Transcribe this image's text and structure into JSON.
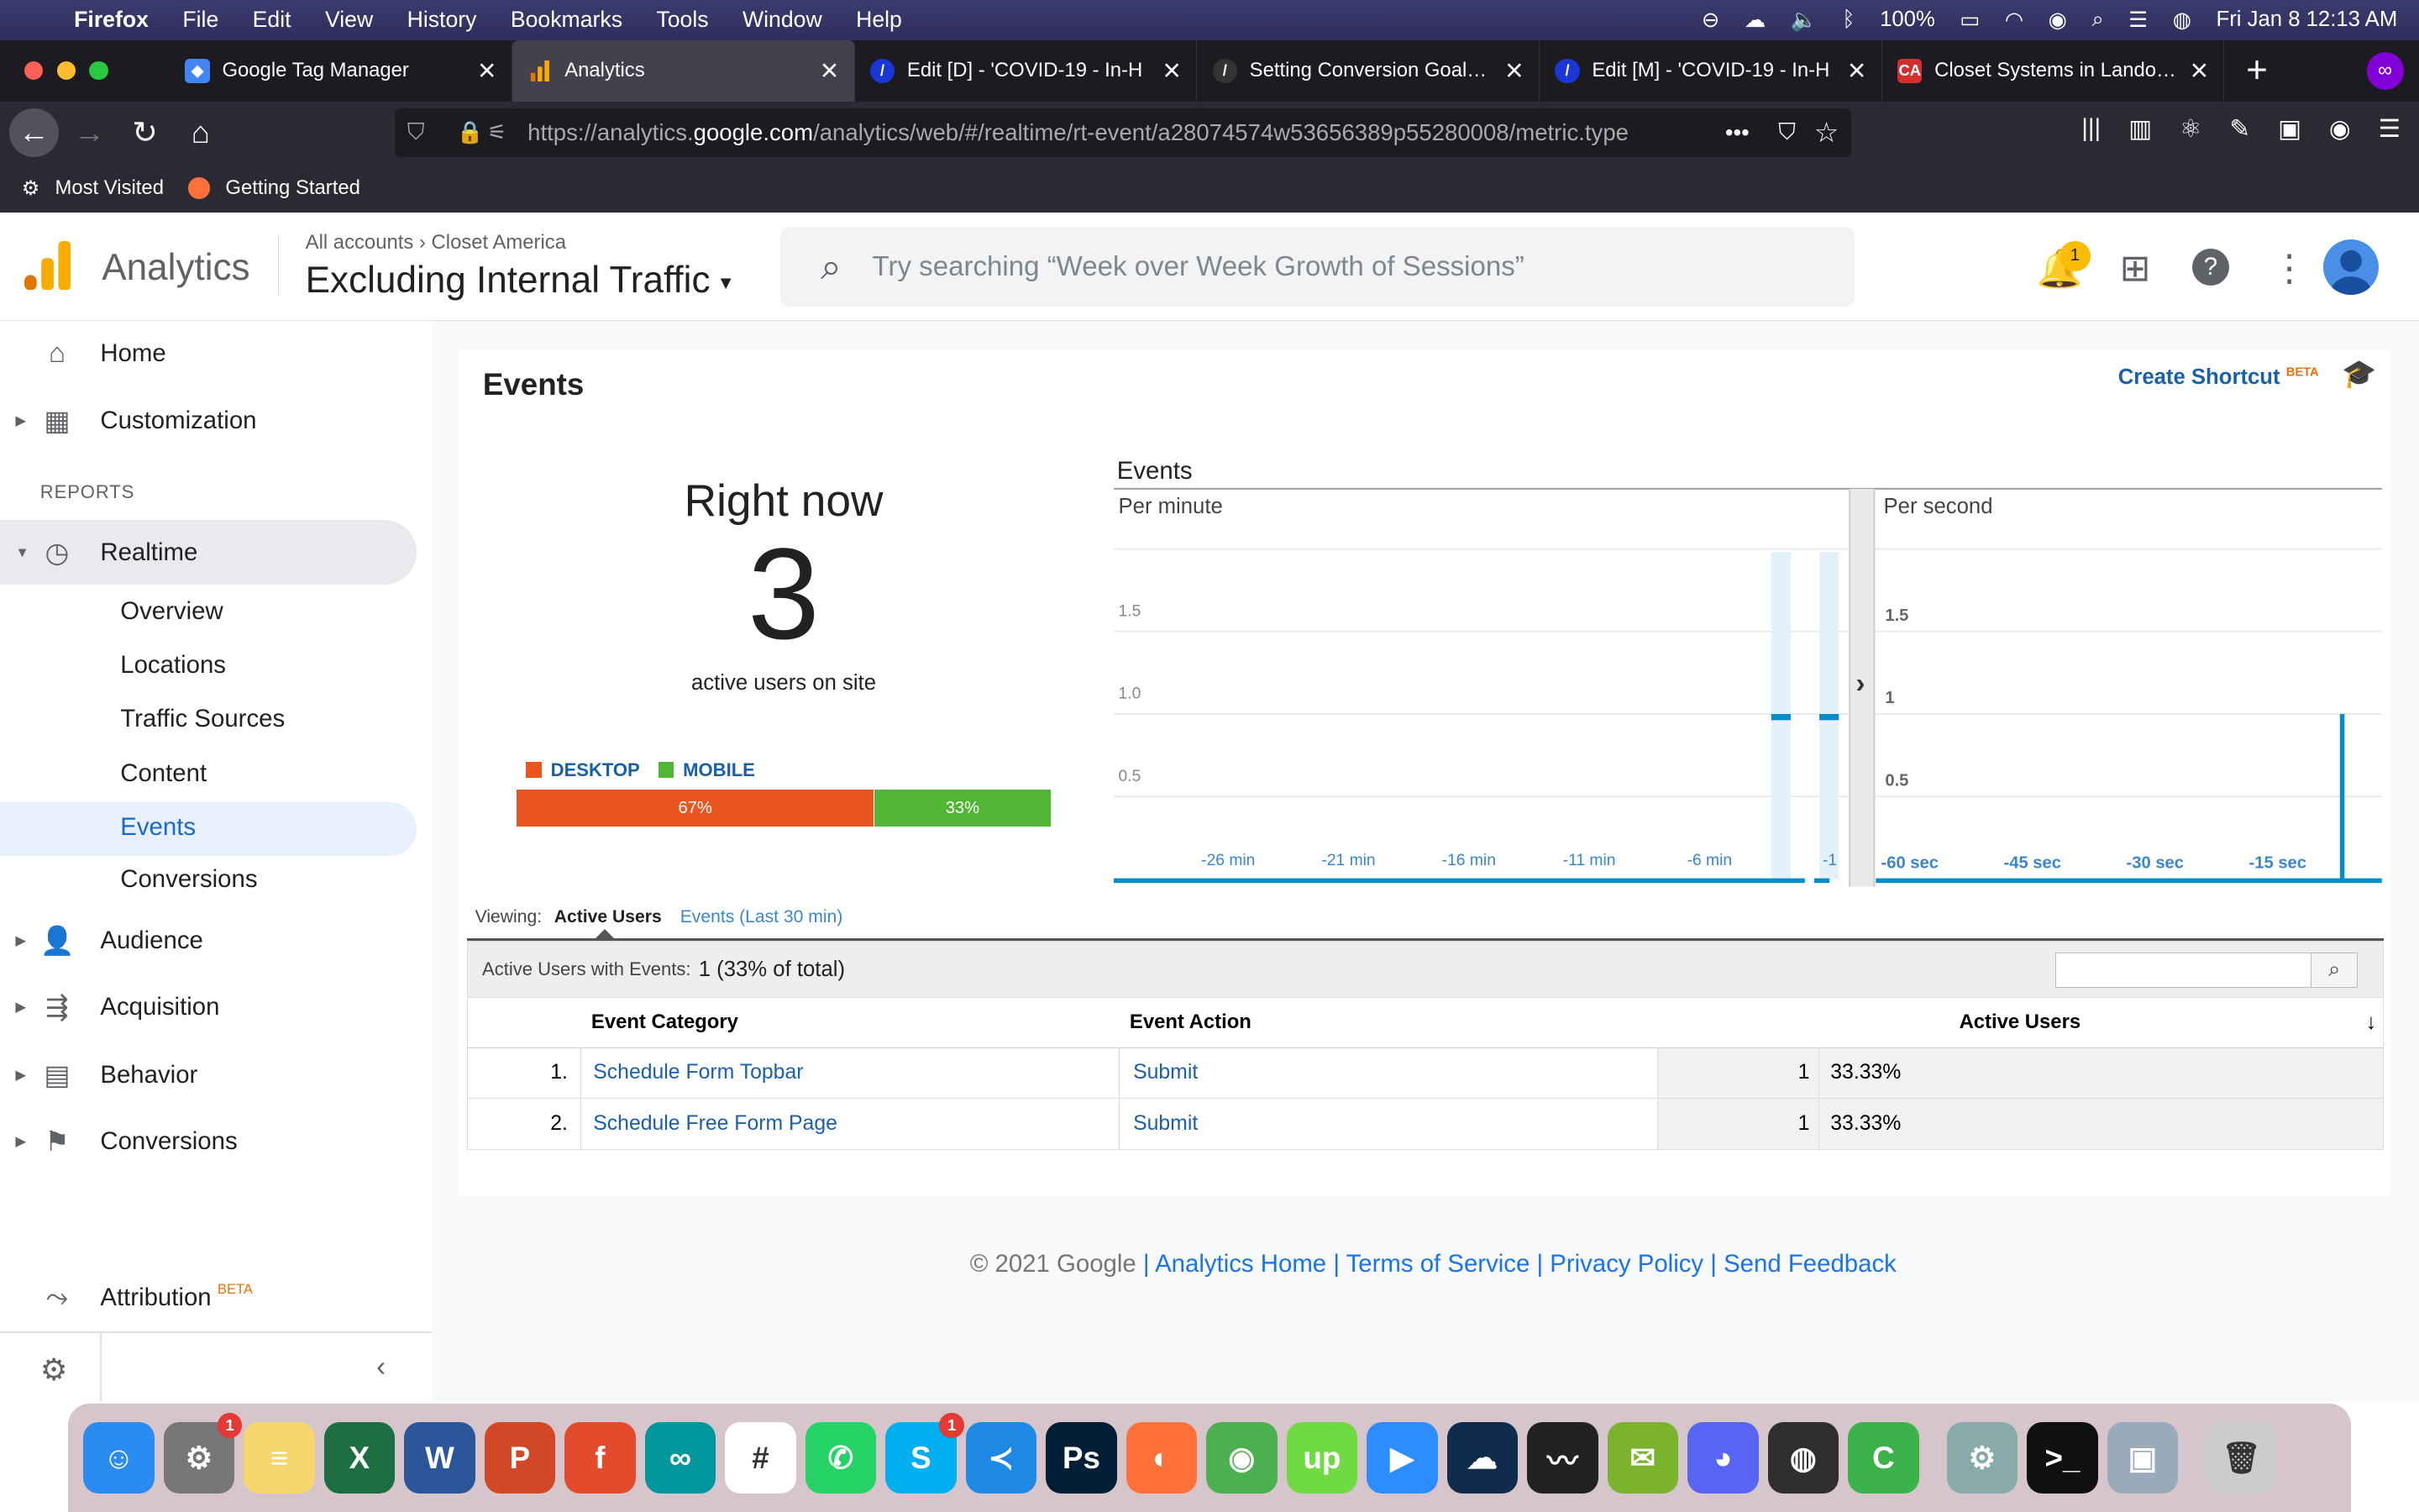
{
  "menubar": {
    "app": "Firefox",
    "items": [
      "File",
      "Edit",
      "View",
      "History",
      "Bookmarks",
      "Tools",
      "Window",
      "Help"
    ],
    "battery": "100%",
    "datetime": "Fri Jan 8  12:13 AM"
  },
  "tabs": [
    {
      "title": "Google Tag Manager",
      "favicon_color": "#4285f4"
    },
    {
      "title": "Analytics",
      "favicon_color": "#f9ab00"
    },
    {
      "title": "Edit [D] - 'COVID-19 - In-H",
      "favicon_color": "#1a37d6"
    },
    {
      "title": "Setting Conversion Goals –",
      "favicon_color": "#333333"
    },
    {
      "title": "Edit [M] - 'COVID-19 - In-H",
      "favicon_color": "#1a37d6"
    },
    {
      "title": "Closet Systems in Landover",
      "favicon_color": "#d32f2f"
    }
  ],
  "url": {
    "prefix": "https://analytics.",
    "domain": "google.com",
    "rest": "/analytics/web/#/realtime/rt-event/a28074574w53656389p55280008/metric.type"
  },
  "bookmarks": [
    "Most Visited",
    "Getting Started"
  ],
  "ga": {
    "product": "Analytics",
    "breadcrumb_all": "All accounts",
    "breadcrumb_sep": "›",
    "breadcrumb_account": "Closet America",
    "view_name": "Excluding Internal Traffic",
    "search_placeholder": "Try searching “Week over Week Growth of Sessions”",
    "notif_count": "1"
  },
  "sidebar": {
    "home": "Home",
    "customization": "Customization",
    "reports_header": "REPORTS",
    "realtime": "Realtime",
    "realtime_sub": [
      "Overview",
      "Locations",
      "Traffic Sources",
      "Content",
      "Events",
      "Conversions"
    ],
    "audience": "Audience",
    "acquisition": "Acquisition",
    "behavior": "Behavior",
    "conversions": "Conversions",
    "attribution": "Attribution",
    "attribution_badge": "BETA"
  },
  "report": {
    "title": "Events",
    "create_shortcut": "Create Shortcut",
    "create_badge": "BETA",
    "right_now": "Right now",
    "active_users": "3",
    "active_label": "active users on site",
    "desktop_label": "DESKTOP",
    "mobile_label": "MOBILE",
    "desktop_pct": "67%",
    "mobile_pct": "33%",
    "desktop_share": 0.67,
    "chart_title": "Events",
    "per_minute": "Per minute",
    "per_second": "Per second",
    "viewing_label": "Viewing:",
    "viewing_active": "Active Users",
    "viewing_events": "Events (Last 30 min)",
    "summary_label": "Active Users with Events:",
    "summary_value": "1 (33% of total)",
    "columns": [
      "Event Category",
      "Event Action",
      "Active Users"
    ],
    "rows": [
      {
        "idx": "1.",
        "category": "Schedule Form Topbar",
        "action": "Submit",
        "users": "1",
        "pct": "33.33%"
      },
      {
        "idx": "2.",
        "category": "Schedule Free Form Page",
        "action": "Submit",
        "users": "1",
        "pct": "33.33%"
      }
    ]
  },
  "footer": {
    "copyright": "© 2021 Google",
    "links": [
      "Analytics Home",
      "Terms of Service",
      "Privacy Policy",
      "Send Feedback"
    ]
  },
  "chart_data": [
    {
      "type": "bar",
      "title": "Per minute",
      "x_ticks": [
        "-26 min",
        "-21 min",
        "-16 min",
        "-11 min",
        "-6 min",
        "-1"
      ],
      "y_ticks": [
        "0.5",
        "1.0",
        "1.5"
      ],
      "ylim": [
        0,
        2
      ],
      "x": [
        -30,
        -29,
        -28,
        -27,
        -26,
        -25,
        -24,
        -23,
        -22,
        -21,
        -20,
        -19,
        -18,
        -17,
        -16,
        -15,
        -14,
        -13,
        -12,
        -11,
        -10,
        -9,
        -8,
        -7,
        -6,
        -5,
        -4,
        -3,
        -2,
        -1
      ],
      "values": [
        0,
        0,
        0,
        0,
        0,
        0,
        0,
        0,
        0,
        0,
        0,
        0,
        0,
        0,
        0,
        0,
        0,
        0,
        0,
        0,
        0,
        0,
        0,
        0,
        0,
        0,
        0,
        1,
        0,
        1
      ]
    },
    {
      "type": "bar",
      "title": "Per second",
      "x_ticks": [
        "-60 sec",
        "-45 sec",
        "-30 sec",
        "-15 sec"
      ],
      "y_ticks": [
        "0.5",
        "1",
        "1.5"
      ],
      "ylim": [
        0,
        2
      ],
      "x": [
        -4
      ],
      "values": [
        1
      ]
    }
  ],
  "dock": [
    {
      "name": "finder",
      "color": "#2a8cf0",
      "label": "☺"
    },
    {
      "name": "system-preferences",
      "color": "#777",
      "label": "⚙",
      "badge": "1"
    },
    {
      "name": "notes",
      "color": "#f5d76e",
      "label": "≡"
    },
    {
      "name": "excel",
      "color": "#1d6f42",
      "label": "X"
    },
    {
      "name": "word",
      "color": "#2b579a",
      "label": "W"
    },
    {
      "name": "powerpoint",
      "color": "#d24726",
      "label": "P"
    },
    {
      "name": "fontforge",
      "color": "#e34b2d",
      "label": "f"
    },
    {
      "name": "arduino",
      "color": "#00979c",
      "label": "∞"
    },
    {
      "name": "slack",
      "color": "#fff",
      "label": "#"
    },
    {
      "name": "whatsapp",
      "color": "#25d366",
      "label": "✆"
    },
    {
      "name": "skype",
      "color": "#00aff0",
      "label": "S",
      "badge": "1"
    },
    {
      "name": "vscode",
      "color": "#1e88e5",
      "label": "≺"
    },
    {
      "name": "photoshop",
      "color": "#001e36",
      "label": "Ps"
    },
    {
      "name": "firefox",
      "color": "#ff7139",
      "label": "◐"
    },
    {
      "name": "chrome",
      "color": "#4caf50",
      "label": "◉"
    },
    {
      "name": "upwork",
      "color": "#6fda44",
      "label": "up"
    },
    {
      "name": "zoom",
      "color": "#2d8cff",
      "label": "▶"
    },
    {
      "name": "cloud-terminal",
      "color": "#0f2c4c",
      "label": "☁"
    },
    {
      "name": "activity-monitor",
      "color": "#222",
      "label": "〰"
    },
    {
      "name": "wechat",
      "color": "#7bb32e",
      "label": "✉"
    },
    {
      "name": "discord",
      "color": "#5865f2",
      "label": "◕"
    },
    {
      "name": "obs",
      "color": "#302e31",
      "label": "◍"
    },
    {
      "name": "camtasia",
      "color": "#3cb34a",
      "label": "C"
    },
    {
      "name": "settings",
      "color": "#8aa",
      "label": "⚙"
    },
    {
      "name": "terminal",
      "color": "#111",
      "label": ">_"
    },
    {
      "name": "preview",
      "color": "#9ab",
      "label": "▣"
    },
    {
      "name": "trash",
      "color": "#ccc",
      "label": "🗑"
    }
  ]
}
